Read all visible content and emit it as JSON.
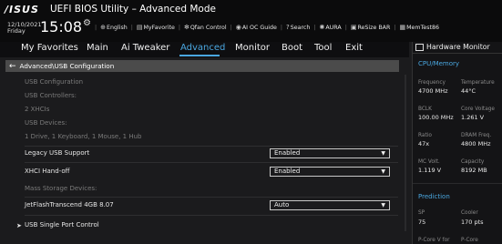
{
  "header": {
    "logo": "/ISUS",
    "title": "UEFI BIOS Utility – Advanced Mode",
    "date": "12/10/2021",
    "day": "Friday",
    "time": "15:08",
    "toolbar": [
      {
        "icon": "globe-icon",
        "label": "English"
      },
      {
        "icon": "star-icon",
        "label": "MyFavorite"
      },
      {
        "icon": "fan-icon",
        "label": "Qfan Control"
      },
      {
        "icon": "ai-oc-icon",
        "label": "AI OC Guide"
      },
      {
        "icon": "question-icon",
        "label": "Search"
      },
      {
        "icon": "aura-icon",
        "label": "AURA"
      },
      {
        "icon": "resize-bar-icon",
        "label": "ReSize BAR"
      },
      {
        "icon": "memtest-icon",
        "label": "MemTest86"
      }
    ]
  },
  "nav": {
    "tabs": [
      "My Favorites",
      "Main",
      "Ai Tweaker",
      "Advanced",
      "Monitor",
      "Boot",
      "Tool",
      "Exit"
    ],
    "active": "Advanced"
  },
  "breadcrumb": "Advanced\\USB Configuration",
  "content": {
    "usb_config": "USB Configuration",
    "usb_controllers_label": "USB Controllers:",
    "usb_controllers_value": "2 XHCIs",
    "usb_devices_label": "USB Devices:",
    "usb_devices_value": "1 Drive, 1 Keyboard, 1 Mouse, 1 Hub",
    "legacy_label": "Legacy USB Support",
    "legacy_value": "Enabled",
    "xhci_label": "XHCI Hand-off",
    "xhci_value": "Enabled",
    "mass_storage_label": "Mass Storage Devices:",
    "jetflash_label": "JetFlashTranscend 4GB 8.07",
    "jetflash_value": "Auto",
    "single_port_label": "USB Single Port Control"
  },
  "hw_monitor": {
    "title": "Hardware Monitor",
    "cpu_section": "CPU/Memory",
    "frequency_label": "Frequency",
    "frequency_value": "4700 MHz",
    "temperature_label": "Temperature",
    "temperature_value": "44°C",
    "bclk_label": "BCLK",
    "bclk_value": "100.00 MHz",
    "core_voltage_label": "Core Voltage",
    "core_voltage_value": "1.261 V",
    "ratio_label": "Ratio",
    "ratio_value": "47x",
    "dram_label": "DRAM Freq.",
    "dram_value": "4800 MHz",
    "mc_volt_label": "MC Volt.",
    "mc_volt_value": "1.119 V",
    "capacity_label": "Capacity",
    "capacity_value": "8192 MB",
    "prediction_section": "Prediction",
    "sp_label": "SP",
    "sp_value": "75",
    "cooler_label": "Cooler",
    "cooler_value": "170 pts",
    "pcore_v_label": "P-Core V for",
    "pcore_label": "P-Core"
  }
}
